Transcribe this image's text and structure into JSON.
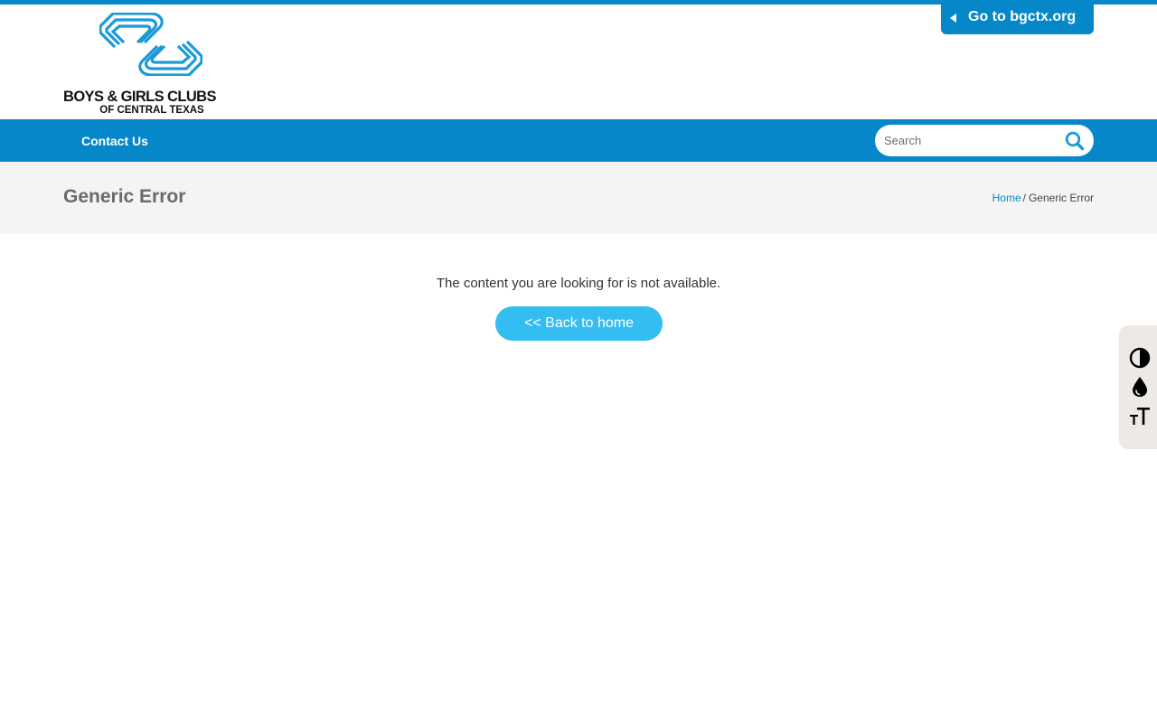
{
  "header": {
    "logo": {
      "icon": "bgc-hands-logo-icon",
      "line1": "BOYS & GIRLS CLUBS",
      "line2": "OF CENTRAL TEXAS"
    },
    "goto_link": {
      "label": "Go to bgctx.org",
      "icon": "caret-left-icon"
    }
  },
  "nav": {
    "items": [
      {
        "label": "Contact Us"
      }
    ],
    "search": {
      "placeholder": "Search",
      "value": "",
      "icon": "search-icon"
    }
  },
  "title_band": {
    "title": "Generic Error",
    "breadcrumb": {
      "home": "Home",
      "separator": "/",
      "current": "Generic Error"
    }
  },
  "main": {
    "message": "The content you are looking for is not available.",
    "back_button": "<< Back to home"
  },
  "accessibility_toolbar": {
    "buttons": [
      {
        "icon": "contrast-icon"
      },
      {
        "icon": "saturation-drop-icon"
      },
      {
        "icon": "text-size-icon"
      }
    ]
  },
  "colors": {
    "brand_blue": "#0687c9",
    "button_blue": "#33bdf0",
    "title_band_bg": "#f4f4f4",
    "title_text": "#6a6a6a",
    "toolbar_bg": "#ede9e6"
  }
}
